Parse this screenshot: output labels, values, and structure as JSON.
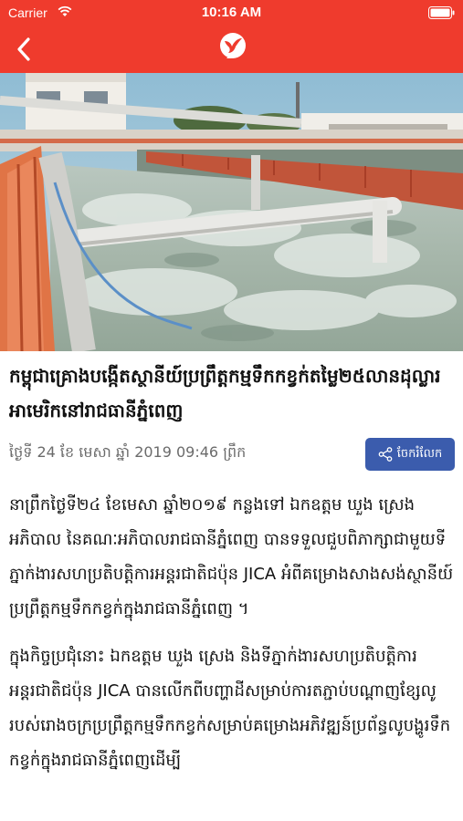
{
  "status_bar": {
    "carrier": "Carrier",
    "time": "10:16 AM"
  },
  "nav": {
    "back_icon": "chevron-left-icon",
    "logo_icon": "bird-logo-icon"
  },
  "colors": {
    "header_bg": "#ef3b2d",
    "share_button_bg": "#3b5cad"
  },
  "article": {
    "image": "water-treatment-plant-photo",
    "title": "កម្ពុជាគ្រោងបង្កើតស្ថានីយ៍ប្រព្រឹត្តកម្មទឹកកខ្វក់តម្លៃ២៥លានដុល្លារអាមេរិកនៅរាជធានីភ្នំពេញ",
    "date": "ថ្ងៃទី 24 ខែ មេសា ឆ្នាំ 2019 09:46 ព្រឹក",
    "share_label": "ចែករំលែក",
    "paragraphs": [
      "នាព្រឹកថ្ងៃទី២៤ ខែមេសា ឆ្នាំ២០១៩ កន្លងទៅ ឯកឧត្តម ឃួង ស្រេង អភិបាល នៃគណៈអភិបាលរាជធានីភ្នំពេញ បានទទួលជួបពិភាក្សាជាមួយទីភ្នាក់ងារសហប្រតិបត្តិការអន្តរជាតិជប៉ុន JICA អំពីគម្រោងសាងសង់ស្ថានីយ៍ប្រព្រឹត្តកម្មទឹកកខ្វក់ក្នុងរាជធានីភ្នំពេញ ។",
      "ក្នុងកិច្ចប្រជុំនោះ ឯកឧត្តម ឃួង ស្រេង និងទីភ្នាក់ងារសហប្រតិបត្តិការអន្តរជាតិជប៉ុន JICA បានលើកពីបញ្ហាដីសម្រាប់ការតភ្ជាប់បណ្តាញខ្សែលូរបស់រោងចក្រប្រព្រឹត្តកម្មទឹកកខ្វក់សម្រាប់គម្រោងអភិវឌ្ឍន៍ប្រព័ន្ធលូបង្ហូរទឹកកខ្វក់ក្នុងរាជធានីភ្នំពេញដើម្បី"
    ]
  }
}
